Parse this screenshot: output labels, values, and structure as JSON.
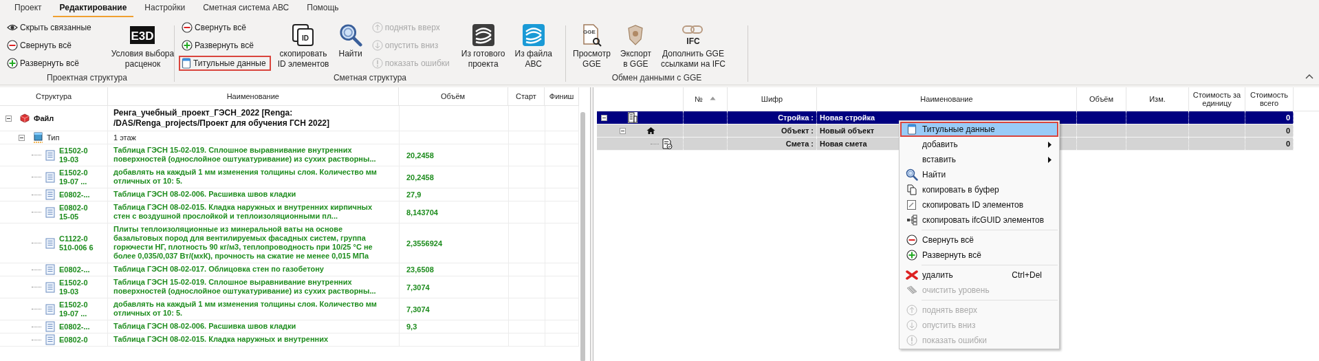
{
  "tabs": [
    {
      "label": "Проект",
      "selected": false
    },
    {
      "label": "Редактирование",
      "selected": true
    },
    {
      "label": "Настройки",
      "selected": false
    },
    {
      "label": "Сметная система АВС",
      "selected": false
    },
    {
      "label": "Помощь",
      "selected": false
    }
  ],
  "ribbon": {
    "groups": [
      {
        "label": "Проектная структура",
        "controls": [
          {
            "kind": "stack",
            "buttons": [
              {
                "label": "Скрыть связанные",
                "disabled": false,
                "highlighted": false
              },
              {
                "label": "Свернуть всё",
                "disabled": false,
                "highlighted": false
              },
              {
                "label": "Развернуть всё",
                "disabled": false,
                "highlighted": false
              }
            ]
          },
          {
            "kind": "large",
            "label_lines": [
              "Условия выбора",
              "расценок"
            ],
            "icon_text": "E3D"
          }
        ]
      },
      {
        "label": "Сметная структура",
        "controls": [
          {
            "kind": "stack",
            "buttons": [
              {
                "label": "Свернуть всё",
                "disabled": false,
                "highlighted": false
              },
              {
                "label": "Развернуть всё",
                "disabled": false,
                "highlighted": false
              },
              {
                "label": "Титульные данные",
                "disabled": false,
                "highlighted": true
              }
            ]
          },
          {
            "kind": "large",
            "label_lines": [
              "скопировать",
              "ID элементов"
            ],
            "icon_text": "ID"
          },
          {
            "kind": "large",
            "label_lines": [
              "Найти"
            ]
          },
          {
            "kind": "stack",
            "buttons": [
              {
                "label": "поднять вверх",
                "disabled": true,
                "highlighted": false
              },
              {
                "label": "опустить вниз",
                "disabled": true,
                "highlighted": false
              },
              {
                "label": "показать ошибки",
                "disabled": true,
                "highlighted": false
              }
            ]
          },
          {
            "kind": "large",
            "label_lines": [
              "Из готового",
              "проекта"
            ]
          },
          {
            "kind": "large",
            "label_lines": [
              "Из файла",
              "АВС"
            ]
          }
        ]
      },
      {
        "label": "Обмен данными с GGE",
        "controls": [
          {
            "kind": "large",
            "label_lines": [
              "Просмотр",
              "GGE"
            ],
            "icon_text": "GGE"
          },
          {
            "kind": "large",
            "label_lines": [
              "Экспорт",
              "в GGE"
            ]
          },
          {
            "kind": "large",
            "label_lines": [
              "Дополнить GGE",
              "ссылками на IFC"
            ],
            "icon_text": "IFC"
          }
        ]
      }
    ]
  },
  "structure": {
    "columns": [
      "Структура",
      "Наименование",
      "Объём",
      "Старт",
      "Финиш"
    ],
    "rows": [
      {
        "kind": "file",
        "label": "Файл",
        "name": "Ренга_учебный_проект_ГЭСН_2022 [Renga: /DAS/Renga_projects/Проект для обучения ГСН 2022]",
        "expanded": true,
        "children": [
          {
            "kind": "type",
            "label": "Тип",
            "name": "1 этаж",
            "expanded": true,
            "children": [
              {
                "kind": "item",
                "label": "E1502-0 19-03",
                "name": "Таблица ГЭСН 15-02-019. Сплошное выравнивание внутренних поверхностей (однослойное оштукатуривание) из сухих растворны...",
                "volume": "20,2458"
              },
              {
                "kind": "item",
                "label": "E1502-0 19-07 ...",
                "name": "добавлять на каждый 1 мм изменения толщины слоя. Количество мм отличных от 10: 5.",
                "volume": "20,2458"
              },
              {
                "kind": "item",
                "label": "E0802-...",
                "name": "Таблица ГЭСН 08-02-006. Расшивка швов кладки",
                "volume": "27,9"
              },
              {
                "kind": "item",
                "label": "E0802-0 15-05",
                "name": "Таблица ГЭСН 08-02-015. Кладка наружных и внутренних кирпичных стен с воздушной прослойкой и теплоизоляционными пл...",
                "volume": "8,143704"
              },
              {
                "kind": "item",
                "label": "C1122-0 510-006 6",
                "name": "Плиты теплоизоляционные из минеральной ваты на основе базальтовых пород для вентилируемых фасадных систем, группа горючести НГ, плотность 90 кг/м3, теплопроводность при 10/25 °С не более 0,035/0,037 Вт/(мхК), прочность на сжатие не менее 0,015 МПа",
                "volume": "2,3556924"
              },
              {
                "kind": "item",
                "label": "E0802-...",
                "name": "Таблица ГЭСН 08-02-017. Облицовка стен по газобетону",
                "volume": "23,6508"
              },
              {
                "kind": "item",
                "label": "E1502-0 19-03",
                "name": "Таблица ГЭСН 15-02-019. Сплошное выравнивание внутренних поверхностей (однослойное оштукатуривание) из сухих растворны...",
                "volume": "7,3074"
              },
              {
                "kind": "item",
                "label": "E1502-0 19-07 ...",
                "name": "добавлять на каждый 1 мм изменения толщины слоя. Количество мм отличных от 10: 5.",
                "volume": "7,3074"
              },
              {
                "kind": "item",
                "label": "E0802-...",
                "name": "Таблица ГЭСН 08-02-006. Расшивка швов кладки",
                "volume": "9,3"
              },
              {
                "kind": "item",
                "label": "E0802-0",
                "name": "Таблица ГЭСН 08-02-015. Кладка наружных и внутренних"
              }
            ]
          }
        ]
      }
    ]
  },
  "estimate": {
    "columns": [
      "№",
      "Шифр",
      "Наименование",
      "Объём",
      "Изм.",
      "Стоимость за единицу",
      "Стоимость всего"
    ],
    "rows": [
      {
        "kind": "construction",
        "type_label": "Стройка :",
        "name": "Новая стройка",
        "total": "0",
        "selected": true,
        "expanded": true,
        "children": [
          {
            "kind": "object",
            "type_label": "Объект :",
            "name": "Новый объект",
            "total": "0",
            "selected": false,
            "expanded": true,
            "children": [
              {
                "kind": "estimate",
                "type_label": "Смета :",
                "name": "Новая смета",
                "total": "0",
                "selected": false
              }
            ]
          }
        ]
      }
    ]
  },
  "context_menu": {
    "items": [
      {
        "kind": "item",
        "label": "Титульные данные",
        "highlighted": true,
        "disabled": false
      },
      {
        "kind": "item",
        "label": "добавить",
        "submenu": true,
        "highlighted": false,
        "disabled": false
      },
      {
        "kind": "item",
        "label": "вставить",
        "submenu": true,
        "highlighted": false,
        "disabled": false
      },
      {
        "kind": "item",
        "label": "Найти",
        "highlighted": false,
        "disabled": false
      },
      {
        "kind": "item",
        "label": "копировать в буфер",
        "highlighted": false,
        "disabled": false
      },
      {
        "kind": "item",
        "label": "скопировать ID элементов",
        "highlighted": false,
        "disabled": false
      },
      {
        "kind": "item",
        "label": "скопировать ifcGUID элементов",
        "highlighted": false,
        "disabled": false
      },
      {
        "kind": "separator"
      },
      {
        "kind": "item",
        "label": "Свернуть всё",
        "highlighted": false,
        "disabled": false
      },
      {
        "kind": "item",
        "label": "Развернуть всё",
        "highlighted": false,
        "disabled": false
      },
      {
        "kind": "separator"
      },
      {
        "kind": "item",
        "label": "удалить",
        "shortcut": "Ctrl+Del",
        "highlighted": false,
        "disabled": false
      },
      {
        "kind": "item",
        "label": "очистить уровень",
        "highlighted": false,
        "disabled": true
      },
      {
        "kind": "separator"
      },
      {
        "kind": "item",
        "label": "поднять вверх",
        "highlighted": false,
        "disabled": true
      },
      {
        "kind": "item",
        "label": "опустить вниз",
        "highlighted": false,
        "disabled": true
      },
      {
        "kind": "item",
        "label": "показать ошибки",
        "highlighted": false,
        "disabled": true
      }
    ]
  }
}
